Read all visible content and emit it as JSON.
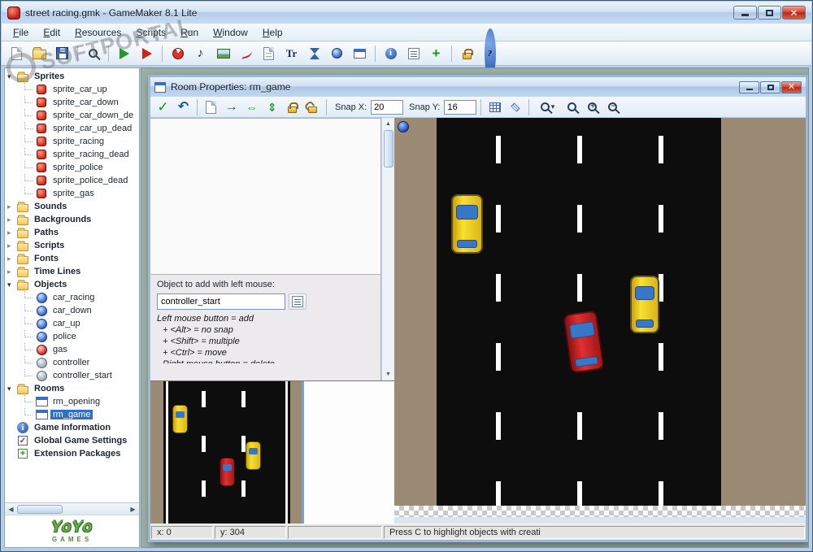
{
  "app": {
    "title": "street racing.gmk - GameMaker 8.1 Lite",
    "menu": [
      {
        "label": "File"
      },
      {
        "label": "Edit"
      },
      {
        "label": "Resources"
      },
      {
        "label": "Scripts"
      },
      {
        "label": "Run"
      },
      {
        "label": "Window"
      },
      {
        "label": "Help"
      }
    ]
  },
  "main_toolbar_icons": [
    "new-file",
    "open-file",
    "save-file",
    "zoom-100",
    "run-game",
    "run-debug",
    "create-sprite",
    "create-sound",
    "create-background",
    "create-path",
    "create-script",
    "create-font",
    "create-timeline",
    "create-object",
    "create-room",
    "game-information",
    "global-game-settings",
    "add-extension",
    "lock",
    "help"
  ],
  "sidebar": {
    "items": [
      {
        "label": "Sprites"
      },
      {
        "label": "sprite_car_up"
      },
      {
        "label": "sprite_car_down"
      },
      {
        "label": "sprite_car_down_de"
      },
      {
        "label": "sprite_car_up_dead"
      },
      {
        "label": "sprite_racing"
      },
      {
        "label": "sprite_racing_dead"
      },
      {
        "label": "sprite_police"
      },
      {
        "label": "sprite_police_dead"
      },
      {
        "label": "sprite_gas"
      },
      {
        "label": "Sounds"
      },
      {
        "label": "Backgrounds"
      },
      {
        "label": "Paths"
      },
      {
        "label": "Scripts"
      },
      {
        "label": "Fonts"
      },
      {
        "label": "Time Lines"
      },
      {
        "label": "Objects"
      },
      {
        "label": "car_racing"
      },
      {
        "label": "car_down"
      },
      {
        "label": "car_up"
      },
      {
        "label": "police"
      },
      {
        "label": "gas"
      },
      {
        "label": "controller"
      },
      {
        "label": "controller_start"
      },
      {
        "label": "Rooms"
      },
      {
        "label": "rm_opening"
      },
      {
        "label": "rm_game"
      },
      {
        "label": "Game Information"
      },
      {
        "label": "Global Game Settings"
      },
      {
        "label": "Extension Packages"
      }
    ],
    "logo": {
      "line1": "YoYo",
      "line2": "GAMES"
    }
  },
  "room_window": {
    "title": "Room Properties: rm_game",
    "toolbar": {
      "snap_x_label": "Snap X:",
      "snap_x_value": "20",
      "snap_y_label": "Snap Y:",
      "snap_y_value": "16"
    },
    "panel": {
      "object_label": "Object to add with left mouse:",
      "object_value": "controller_start",
      "help_lines": [
        "Left mouse button = add",
        "+ <Alt> = no snap",
        "+ <Shift> = multiple",
        "+ <Ctrl> = move",
        "Right mouse button = delete"
      ]
    },
    "status": {
      "x": "x: 0",
      "y": "y: 304",
      "hint": "Press C to highlight objects with creati"
    }
  },
  "watermark": {
    "text": "SOFTPORTAL"
  },
  "colors": {
    "selection": "#2f6fc4",
    "ground": "#9b8a74",
    "road": "#0d0d0d",
    "mdi_background": "#9cb0a4",
    "car_yellow": "#f8e030",
    "car_red": "#e03030"
  }
}
